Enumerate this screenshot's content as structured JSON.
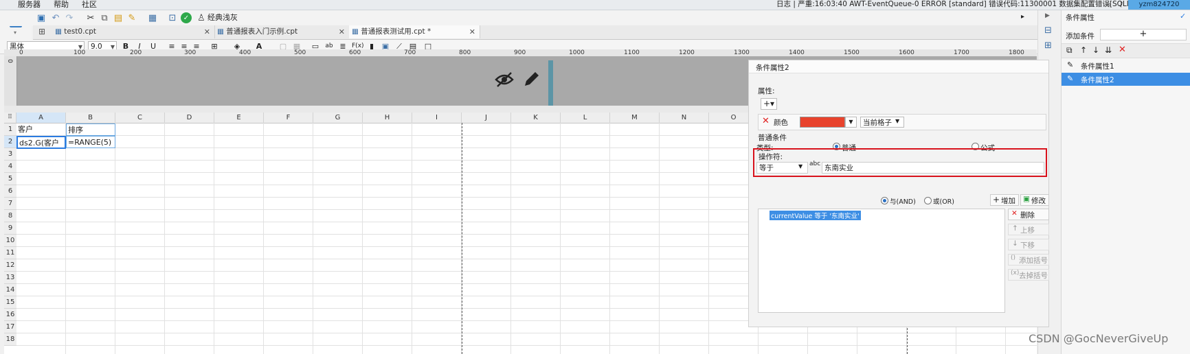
{
  "menubar": {
    "items": [
      "服务器",
      "帮助",
      "社区"
    ],
    "log_text": "日志 | 严重:16:03:40 AWT-EventQueue-0 ERROR [standard] 错误代码:11300001 数据集配置错误[SQLITE_ER...",
    "user": "yzm824720"
  },
  "toolbar": {
    "theme_label": "经典浅灰"
  },
  "tabs": [
    {
      "label": "test0.cpt"
    },
    {
      "label": "普通报表入门示例.cpt"
    },
    {
      "label": "普通报表测试用.cpt *"
    }
  ],
  "format_toolbar": {
    "font_family": "黑体",
    "font_size": "9.0"
  },
  "ruler": {
    "ticks": [
      "0",
      "100",
      "200",
      "300",
      "400",
      "500",
      "600",
      "700",
      "800",
      "900",
      "1000",
      "1100",
      "1200",
      "1300",
      "1400",
      "1500",
      "1600",
      "1700",
      "1800"
    ],
    "vertical_start": "0"
  },
  "grid": {
    "columns": [
      "A",
      "B",
      "C",
      "D",
      "E",
      "F",
      "G",
      "H",
      "I",
      "J",
      "K",
      "L",
      "M",
      "N",
      "O"
    ],
    "rows": [
      "1",
      "2",
      "3",
      "4",
      "5",
      "6",
      "7",
      "8",
      "9",
      "10",
      "11",
      "12",
      "13",
      "14",
      "15",
      "16",
      "17",
      "18"
    ],
    "cells": {
      "A1": "客户",
      "B1": "排序",
      "A2": "ds2.G(客户",
      "B2": "=RANGE(5)"
    }
  },
  "dialog": {
    "title": "条件属性2",
    "attributes_label": "属性:",
    "color_label": "颜色",
    "color_value": "#e8432d",
    "scope_value": "当前格子",
    "normal_condition_label": "普通条件",
    "type_label": "类型:",
    "type_normal": "普通",
    "type_formula": "公式",
    "operator_label": "操作符:",
    "operator_value": "等于",
    "operand_value": "东南实业",
    "and_label": "与(AND)",
    "or_label": "或(OR)",
    "add_button": "增加",
    "modify_button": "修改",
    "condition_expression": "currentValue 等于 '东南实业'",
    "delete_button": "删除",
    "move_up_button": "上移",
    "move_down_button": "下移",
    "add_bracket_button": "添加括号",
    "remove_bracket_button": "去掉括号"
  },
  "right_panel": {
    "title": "条件属性",
    "add_condition_label": "添加条件",
    "conditions": [
      "条件属性1",
      "条件属性2"
    ]
  },
  "watermark": "CSDN @GocNeverGiveUp",
  "colors": {
    "accent": "#3d8ee4",
    "selection": "#d5e6f7",
    "highlight_box": "#d8121c"
  }
}
